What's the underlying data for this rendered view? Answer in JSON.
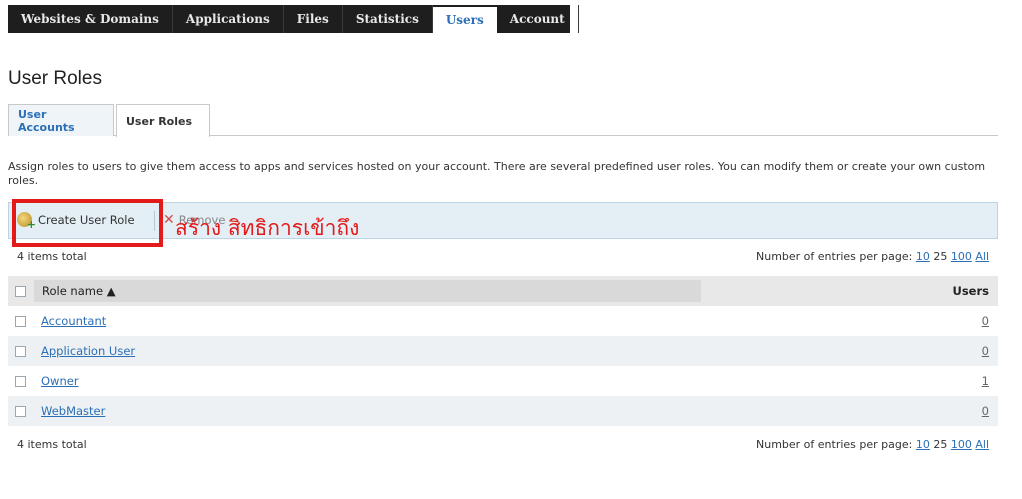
{
  "nav": {
    "tabs": [
      "Websites & Domains",
      "Applications",
      "Files",
      "Statistics",
      "Users",
      "Account"
    ],
    "active": "Users"
  },
  "page": {
    "title": "User Roles"
  },
  "subtabs": {
    "user_accounts": "User Accounts",
    "user_roles": "User Roles"
  },
  "description": "Assign roles to users to give them access to apps and services hosted on your account. There are several predefined user roles. You can modify them or create your own custom roles.",
  "toolbar": {
    "create_label": "Create User Role",
    "remove_label": "Remove",
    "annotation": "สร้าง สิทธิการเข้าถึง"
  },
  "list": {
    "items_total": "4 items total",
    "entries_label": "Number of entries per page:",
    "entries_options": [
      "10",
      "25",
      "100",
      "All"
    ],
    "entries_current": "25",
    "columns": {
      "role_name": "Role name ▲",
      "users": "Users"
    },
    "rows": [
      {
        "name": "Accountant",
        "users": "0"
      },
      {
        "name": "Application User",
        "users": "0"
      },
      {
        "name": "Owner",
        "users": "1"
      },
      {
        "name": "WebMaster",
        "users": "0"
      }
    ]
  },
  "colors": {
    "highlight": "#e31a1a",
    "link": "#2b6fb6",
    "toolbar_bg": "#e3eef5"
  }
}
